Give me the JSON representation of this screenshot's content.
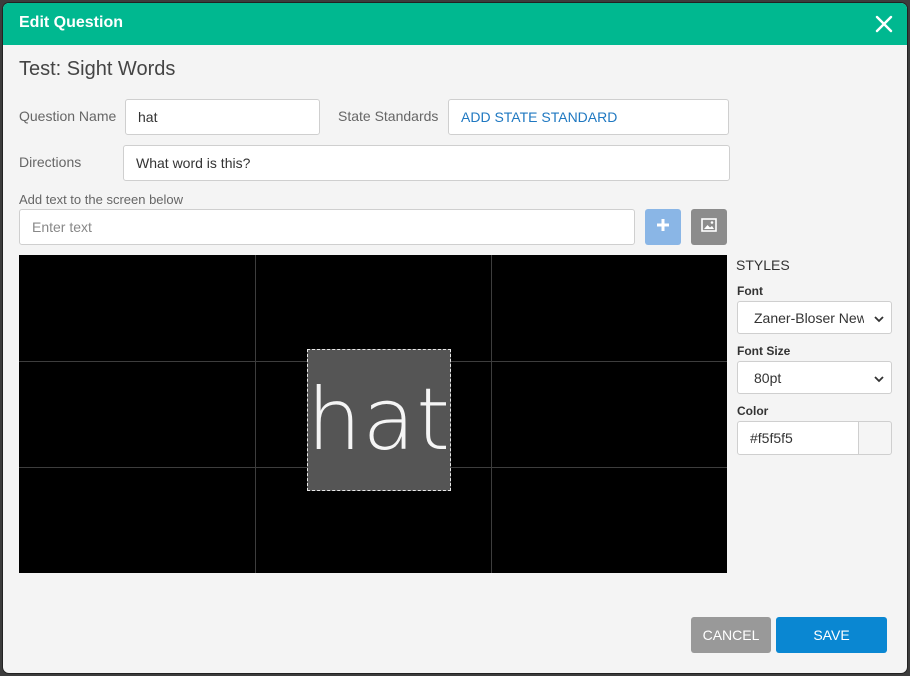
{
  "dialog": {
    "title": "Edit Question",
    "close_icon": "close-icon",
    "test_title": "Test: Sight Words"
  },
  "form": {
    "question_name_label": "Question Name",
    "question_name_value": "hat",
    "state_standards_label": "State Standards",
    "state_standards_button": "ADD STATE STANDARD",
    "directions_label": "Directions",
    "directions_value": "What word is this?",
    "add_text_label": "Add text to the screen below",
    "add_text_placeholder": "Enter text"
  },
  "stage": {
    "text": "hat",
    "text_color": "#f5f5f5",
    "background_color": "#000000"
  },
  "styles": {
    "heading": "STYLES",
    "font_label": "Font",
    "font_value": "Zaner-Bloser New",
    "font_size_label": "Font Size",
    "font_size_value": "80pt",
    "color_label": "Color",
    "color_value": "#f5f5f5"
  },
  "footer": {
    "cancel_label": "CANCEL",
    "save_label": "SAVE"
  },
  "colors": {
    "accent": "#00b890",
    "save": "#0a87d2",
    "add_button": "#8ab6e6",
    "link": "#1f78c1"
  }
}
